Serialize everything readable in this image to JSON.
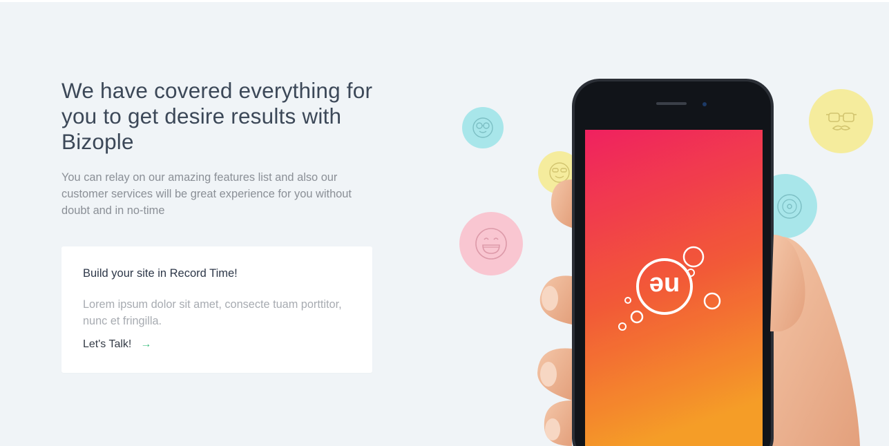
{
  "hero": {
    "title": "We have covered everything for you to get desire results with Bizople",
    "description": "You can relay on our amazing features list and also our customer services will be great experience for you without doubt and in no-time"
  },
  "card": {
    "title": "Build your site in Record Time!",
    "text": "Lorem ipsum dolor sit amet, consecte tuam porttitor, nunc et fringilla.",
    "link_label": "Let's Talk!",
    "link_arrow": "→"
  },
  "visual": {
    "app_logo_text": "ne",
    "icons": [
      "nerd-face-icon",
      "sunglasses-face-icon",
      "laughing-face-icon",
      "glasses-mustache-icon",
      "music-disc-icon"
    ],
    "colors": {
      "background": "#f0f4f7",
      "accent_green": "#3fbf7f",
      "bubble_cyan": "#a8e6ea",
      "bubble_yellow": "#f5ec9d",
      "bubble_pink": "#f9c6d1",
      "screen_top": "#f0195a",
      "screen_bottom": "#f59020"
    }
  }
}
